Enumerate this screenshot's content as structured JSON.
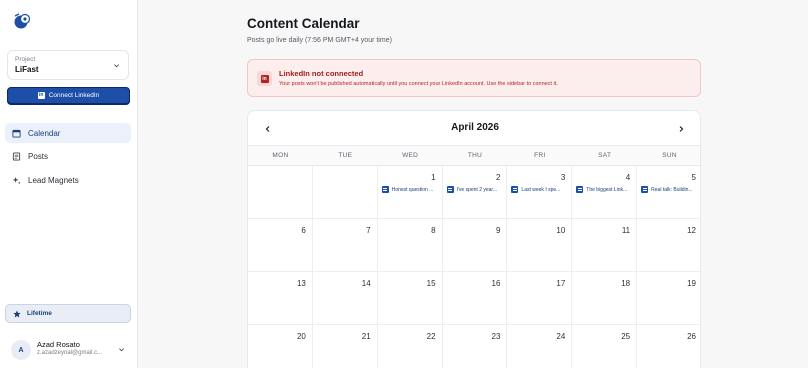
{
  "sidebar": {
    "project_label": "Project",
    "project_name": "LiFast",
    "connect_label": "Connect LinkedIn",
    "nav": [
      {
        "label": "Calendar",
        "icon": "calendar-icon",
        "active": true
      },
      {
        "label": "Posts",
        "icon": "document-icon",
        "active": false
      },
      {
        "label": "Lead Magnets",
        "icon": "sparkle-icon",
        "active": false
      }
    ],
    "plan_label": "Lifetime",
    "user": {
      "initial": "A",
      "name": "Azad Rosato",
      "email": "z.azadzeynal@gmail.c..."
    }
  },
  "main": {
    "title": "Content Calendar",
    "subtitle": "Posts go live daily (7:56 PM GMT+4 your time)",
    "alert": {
      "title": "LinkedIn not connected",
      "text": "Your posts won't be published automatically until you connect your LinkedIn account. Use the sidebar to connect it."
    },
    "calendar": {
      "month": "April 2026",
      "weekdays": [
        "MON",
        "TUE",
        "WED",
        "THU",
        "FRI",
        "SAT",
        "SUN"
      ],
      "cells": [
        {
          "day": "",
          "post": ""
        },
        {
          "day": "",
          "post": ""
        },
        {
          "day": "1",
          "post": "Honest question ..."
        },
        {
          "day": "2",
          "post": "I've spent 2 year..."
        },
        {
          "day": "3",
          "post": "Last week I spe..."
        },
        {
          "day": "4",
          "post": "The biggest Link..."
        },
        {
          "day": "5",
          "post": "Real talk: Buildin..."
        },
        {
          "day": "6",
          "post": ""
        },
        {
          "day": "7",
          "post": ""
        },
        {
          "day": "8",
          "post": ""
        },
        {
          "day": "9",
          "post": ""
        },
        {
          "day": "10",
          "post": ""
        },
        {
          "day": "11",
          "post": ""
        },
        {
          "day": "12",
          "post": ""
        },
        {
          "day": "13",
          "post": ""
        },
        {
          "day": "14",
          "post": ""
        },
        {
          "day": "15",
          "post": ""
        },
        {
          "day": "16",
          "post": ""
        },
        {
          "day": "17",
          "post": ""
        },
        {
          "day": "18",
          "post": ""
        },
        {
          "day": "19",
          "post": ""
        },
        {
          "day": "20",
          "post": ""
        },
        {
          "day": "21",
          "post": ""
        },
        {
          "day": "22",
          "post": ""
        },
        {
          "day": "23",
          "post": ""
        },
        {
          "day": "24",
          "post": ""
        },
        {
          "day": "25",
          "post": ""
        },
        {
          "day": "26",
          "post": ""
        }
      ]
    }
  },
  "colors": {
    "accent": "#1d4fa8",
    "alert_bg": "#fdeeee",
    "alert_text": "#9b1c1c"
  }
}
